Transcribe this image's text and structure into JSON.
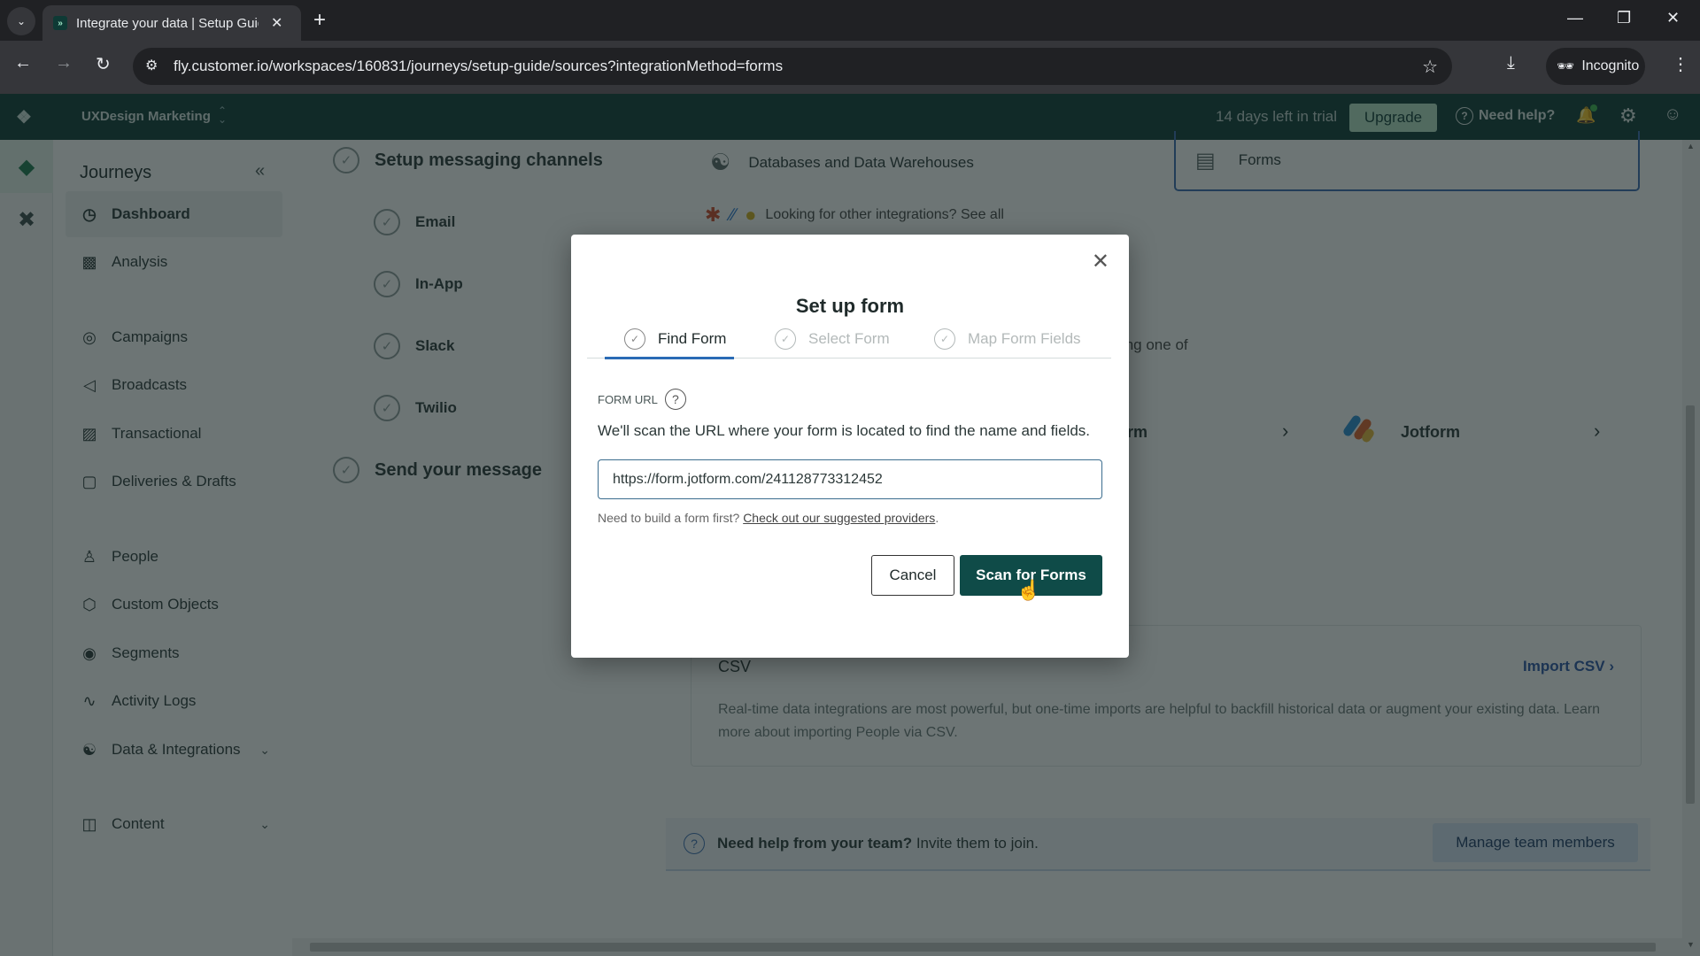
{
  "browser": {
    "tab_title": "Integrate your data | Setup Guide",
    "url": "fly.customer.io/workspaces/160831/journeys/setup-guide/sources?integrationMethod=forms",
    "incognito_label": "Incognito"
  },
  "topbar": {
    "workspace": "UXDesign Marketing",
    "trial_text": "14 days left in trial",
    "upgrade_label": "Upgrade",
    "help_label": "Need help?"
  },
  "sidebar": {
    "title": "Journeys",
    "items": [
      {
        "label": "Dashboard",
        "icon": "dashboard-icon",
        "active": true
      },
      {
        "label": "Analysis",
        "icon": "bar-chart-icon"
      },
      {
        "label": "Campaigns",
        "icon": "campaigns-icon"
      },
      {
        "label": "Broadcasts",
        "icon": "megaphone-icon"
      },
      {
        "label": "Transactional",
        "icon": "terminal-icon"
      },
      {
        "label": "Deliveries & Drafts",
        "icon": "inbox-icon"
      },
      {
        "label": "People",
        "icon": "person-icon"
      },
      {
        "label": "Custom Objects",
        "icon": "cube-icon"
      },
      {
        "label": "Segments",
        "icon": "segments-icon"
      },
      {
        "label": "Activity Logs",
        "icon": "pulse-icon"
      },
      {
        "label": "Data & Integrations",
        "icon": "database-icon",
        "expandable": true
      },
      {
        "label": "Content",
        "icon": "layout-icon",
        "expandable": true
      }
    ]
  },
  "setup_steps": {
    "messaging": "Setup messaging channels",
    "channels": [
      "Email",
      "In-App",
      "Slack",
      "Twilio"
    ],
    "send": "Send your message"
  },
  "sources": {
    "databases_label": "Databases and Data Warehouses",
    "forms_label": "Forms",
    "integrations_teaser": "Looking for other integrations? See all",
    "description_fragment": "stomer.io. You can also use custom forms built by you or using one of",
    "providers": [
      {
        "label": "orm"
      },
      {
        "label": "Jotform"
      }
    ],
    "csv": {
      "title": "CSV",
      "link": "Import CSV",
      "text": "Real-time data integrations are most powerful, but one-time imports are helpful to backfill historical data or augment your existing data. Learn more about importing People via CSV."
    },
    "team_banner": {
      "bold": "Need help from your team?",
      "text": " Invite them to join.",
      "button": "Manage team members"
    }
  },
  "modal": {
    "title": "Set up form",
    "steps": [
      {
        "label": "Find Form",
        "active": true
      },
      {
        "label": "Select Form",
        "active": false
      },
      {
        "label": "Map Form Fields",
        "active": false
      }
    ],
    "field_label": "FORM URL",
    "description": "We'll scan the URL where your form is located to find the name and fields.",
    "url_value": "https://form.jotform.com/241128773312452",
    "hint_text": "Need to build a form first? ",
    "hint_link": "Check out our suggested providers",
    "hint_end": ".",
    "cancel_label": "Cancel",
    "scan_label": "Scan for Forms"
  }
}
